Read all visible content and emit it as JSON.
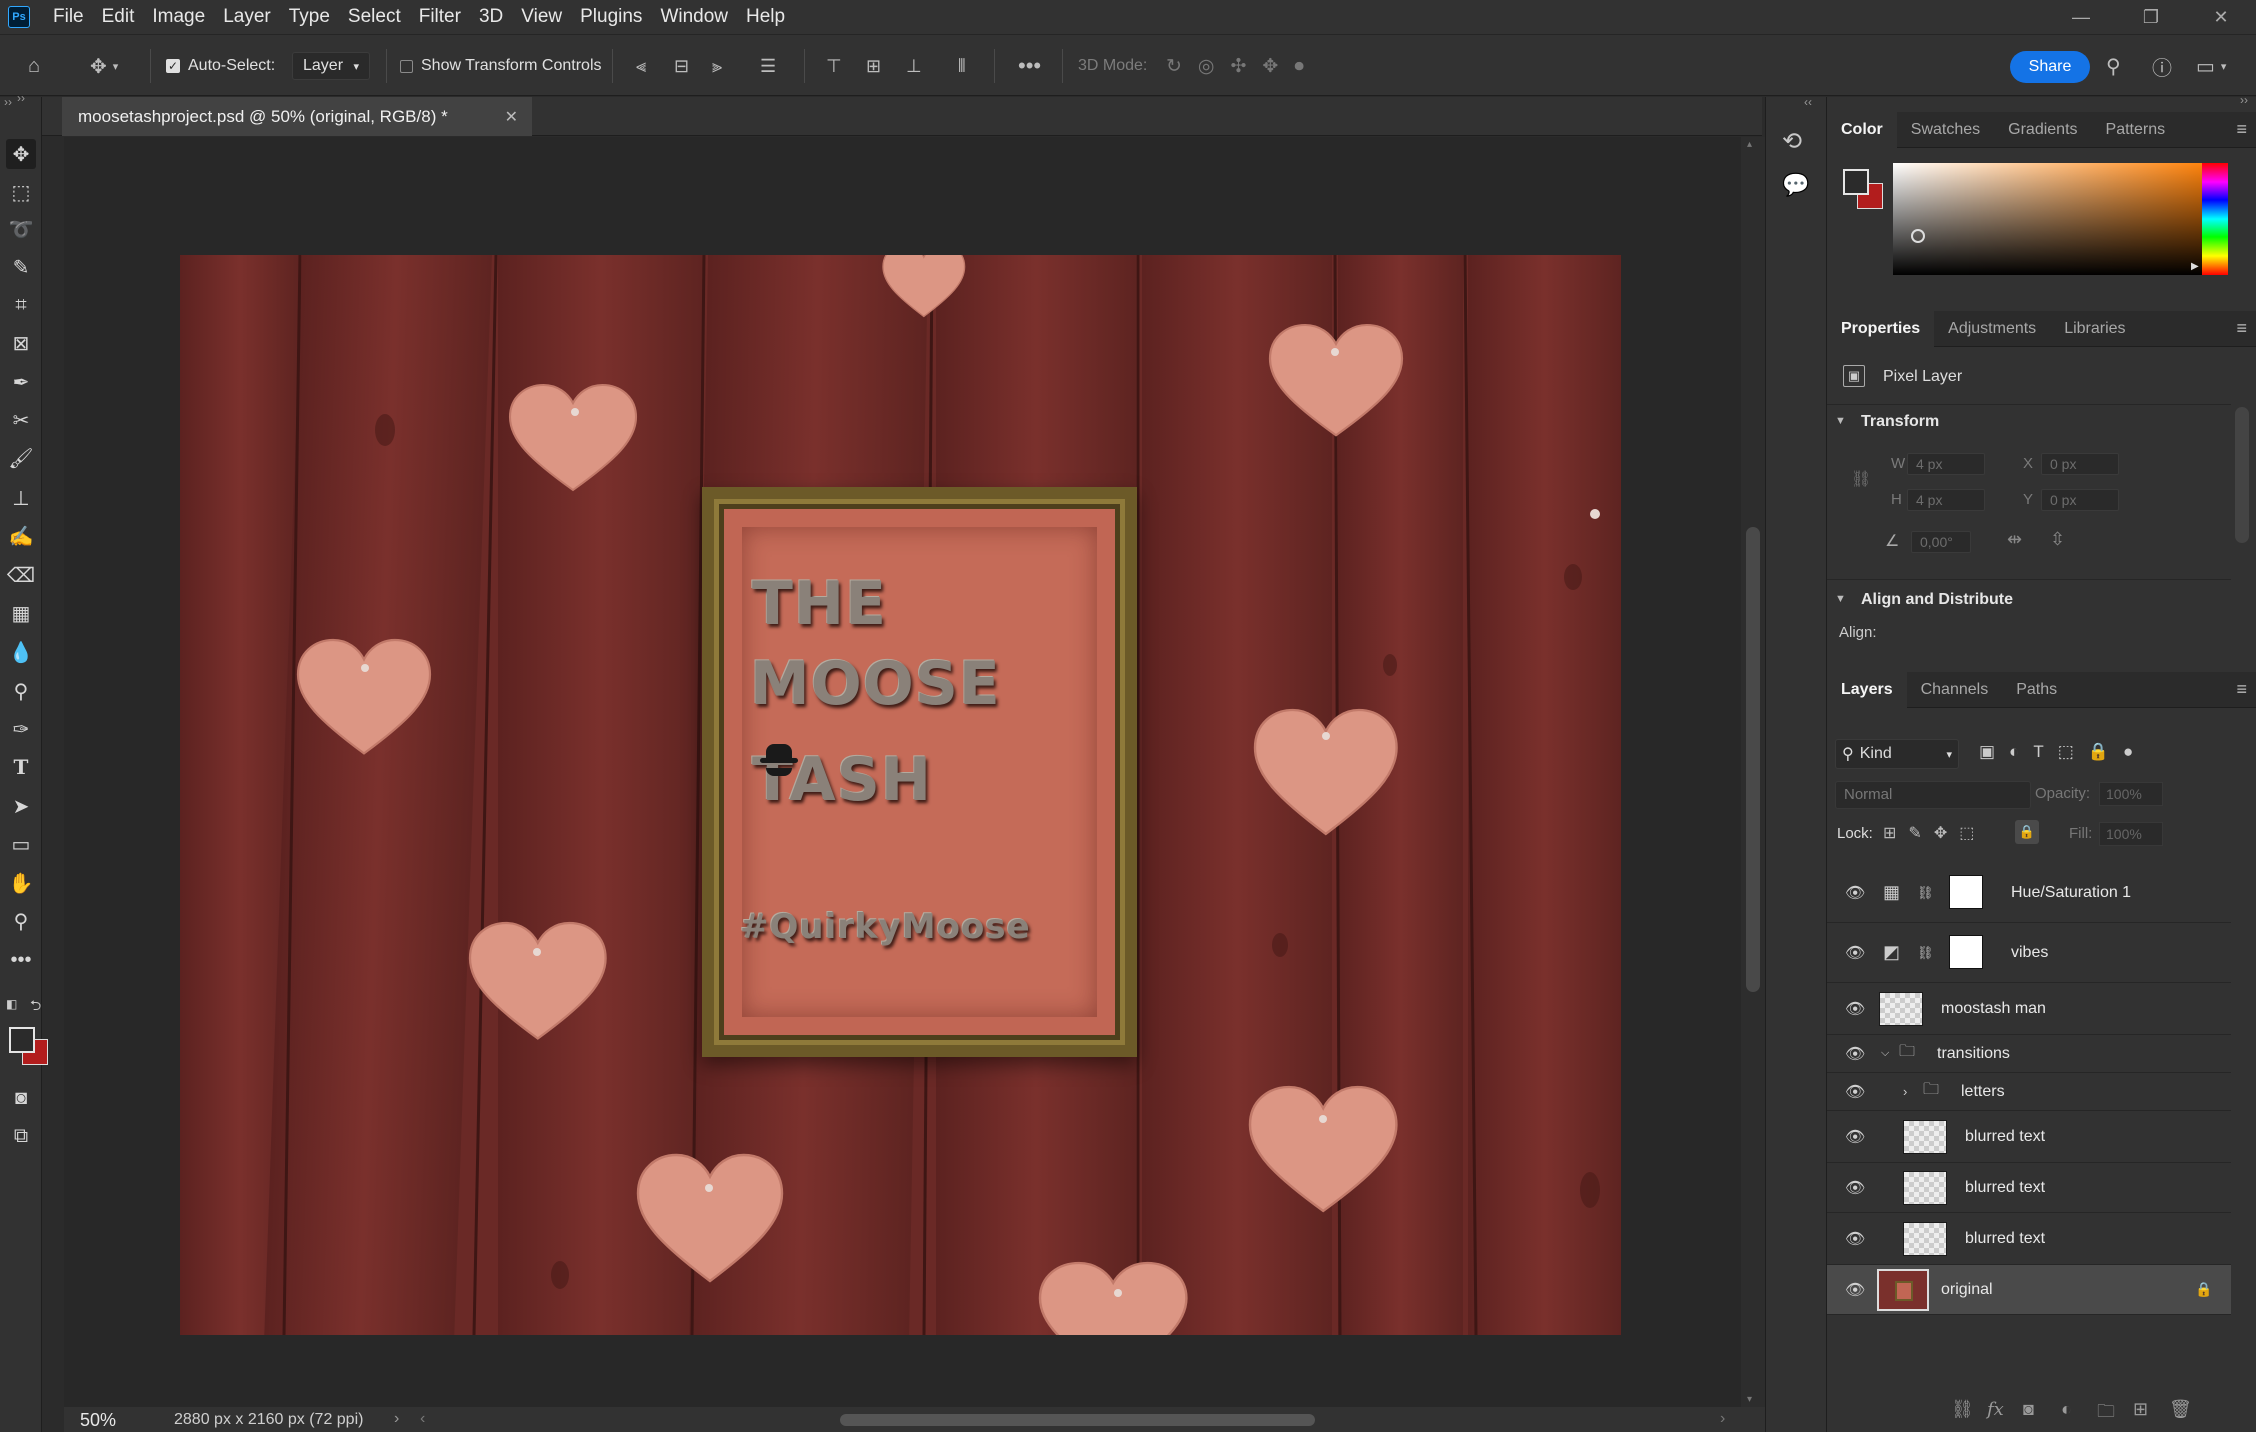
{
  "app": {
    "name": "Photoshop",
    "logo": "Ps"
  },
  "menu": [
    "File",
    "Edit",
    "Image",
    "Layer",
    "Type",
    "Select",
    "Filter",
    "3D",
    "View",
    "Plugins",
    "Window",
    "Help"
  ],
  "options": {
    "auto_select_label": "Auto-Select:",
    "auto_select_checked": true,
    "auto_select_target": "Layer",
    "show_transform_label": "Show Transform Controls",
    "show_transform_checked": false,
    "mode_label": "3D Mode:",
    "share_label": "Share"
  },
  "document": {
    "tab_title": "moosetashproject.psd @ 50% (original, RGB/8) *",
    "zoom": "50%",
    "info": "2880 px x 2160 px (72 ppi)"
  },
  "artwork": {
    "sign_lines": [
      "THE",
      "MOOSE",
      "TASH"
    ],
    "hashtag": "#QuirkyMoose"
  },
  "color_panel": {
    "tabs": [
      "Color",
      "Swatches",
      "Gradients",
      "Patterns"
    ],
    "active": "Color",
    "foreground": "#2b2b2b",
    "background": "#b21d1d",
    "hue_color": "#ff7d00"
  },
  "properties_panel": {
    "tabs": [
      "Properties",
      "Adjustments",
      "Libraries"
    ],
    "active": "Properties",
    "kind_label": "Pixel Layer",
    "transform": {
      "title": "Transform",
      "w_label": "W",
      "w": "4 px",
      "h_label": "H",
      "h": "4 px",
      "x_label": "X",
      "x": "0 px",
      "y_label": "Y",
      "y": "0 px",
      "angle": "0,00°"
    },
    "align": {
      "title": "Align and Distribute",
      "label": "Align:"
    }
  },
  "layers_panel": {
    "tabs": [
      "Layers",
      "Channels",
      "Paths"
    ],
    "active": "Layers",
    "filter_kind": "Kind",
    "blend_mode": "Normal",
    "opacity_label": "Opacity:",
    "opacity": "100%",
    "lock_label": "Lock:",
    "fill_label": "Fill:",
    "fill": "100%",
    "layers": [
      {
        "name": "Hue/Saturation 1",
        "type": "adjustment",
        "visible": true
      },
      {
        "name": "vibes",
        "type": "adjustment",
        "visible": true
      },
      {
        "name": "moostash man",
        "type": "pixel",
        "visible": true
      },
      {
        "name": "transitions",
        "type": "group",
        "visible": true,
        "expanded": true
      },
      {
        "name": "letters",
        "type": "group",
        "visible": true,
        "expanded": false
      },
      {
        "name": "blurred text",
        "type": "pixel",
        "visible": true
      },
      {
        "name": "blurred text",
        "type": "pixel",
        "visible": true
      },
      {
        "name": "blurred text",
        "type": "pixel",
        "visible": true
      },
      {
        "name": "original",
        "type": "pixel",
        "visible": true,
        "selected": true,
        "locked": true
      }
    ]
  }
}
